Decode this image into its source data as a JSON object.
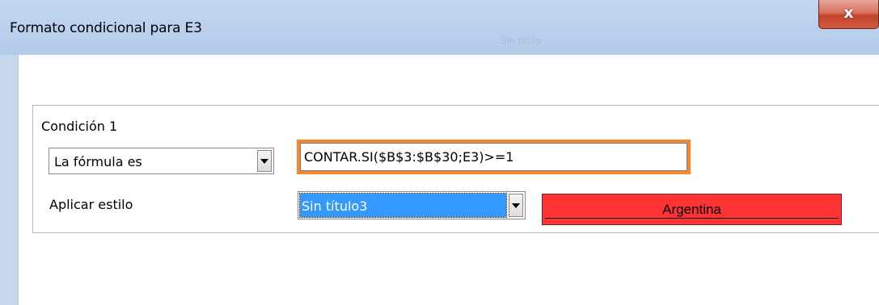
{
  "window": {
    "title": "Formato condicional para E3",
    "ghost_title": "Sin título",
    "close_glyph": "x"
  },
  "condition": {
    "label": "Condición 1",
    "type_selected": "La fórmula es",
    "formula": "CONTAR.SI($B$3:$B$30;E3)>=1",
    "apply_style_label": "Aplicar estilo",
    "style_selected": "Sin título3",
    "preview_text": "Argentina"
  },
  "colors": {
    "preview_bg": "#ff3333",
    "formula_highlight": "#f5882c",
    "selection": "#3399ff"
  },
  "icons": [
    "close-icon",
    "dropdown-arrow-icon"
  ]
}
